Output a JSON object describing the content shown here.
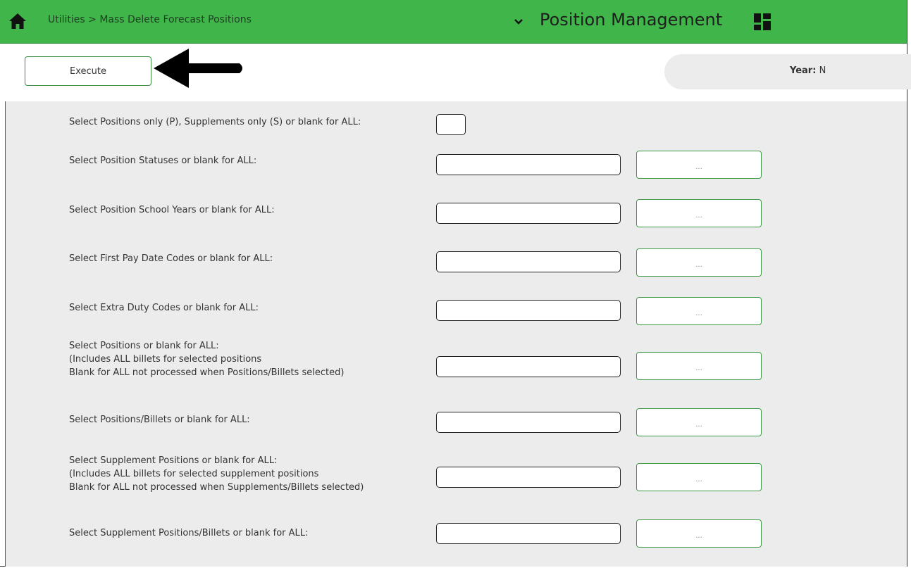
{
  "header": {
    "breadcrumb": "Utilities > Mass Delete Forecast Positions",
    "app_title": "Position Management",
    "bar_color": "#3fb54a"
  },
  "actions": {
    "execute_label": "Execute",
    "year_label": "Year:",
    "year_value": "N"
  },
  "form": {
    "select_label": "Select Positions only (P), Supplements only (S) or blank for ALL:",
    "select_value": "",
    "rows": [
      {
        "lines": [
          "Select Position Statuses or blank for ALL:"
        ],
        "value": "",
        "lookup": "..."
      },
      {
        "lines": [
          "Select Position School Years or blank for ALL:"
        ],
        "value": "",
        "lookup": "..."
      },
      {
        "lines": [
          "Select First Pay Date Codes or blank for ALL:"
        ],
        "value": "",
        "lookup": "..."
      },
      {
        "lines": [
          "Select Extra Duty Codes or blank for ALL:"
        ],
        "value": "",
        "lookup": "..."
      },
      {
        "lines": [
          "Select Positions or blank for ALL:",
          "(Includes ALL billets for selected positions",
          "Blank for ALL not processed when Positions/Billets selected)"
        ],
        "value": "",
        "lookup": "..."
      },
      {
        "lines": [
          "Select Positions/Billets or blank for ALL:"
        ],
        "value": "",
        "lookup": "..."
      },
      {
        "lines": [
          "Select Supplement Positions or blank for ALL:",
          "(Includes ALL billets for selected supplement positions",
          "Blank for ALL not processed when Supplements/Billets selected)"
        ],
        "value": "",
        "lookup": "..."
      },
      {
        "lines": [
          "Select Supplement Positions/Billets or blank for ALL:"
        ],
        "value": "",
        "lookup": "..."
      }
    ]
  },
  "icons": {
    "home": "home-icon",
    "chevron": "chevron-down-icon",
    "grid": "grid-icon",
    "arrow": "arrow-left-icon"
  }
}
